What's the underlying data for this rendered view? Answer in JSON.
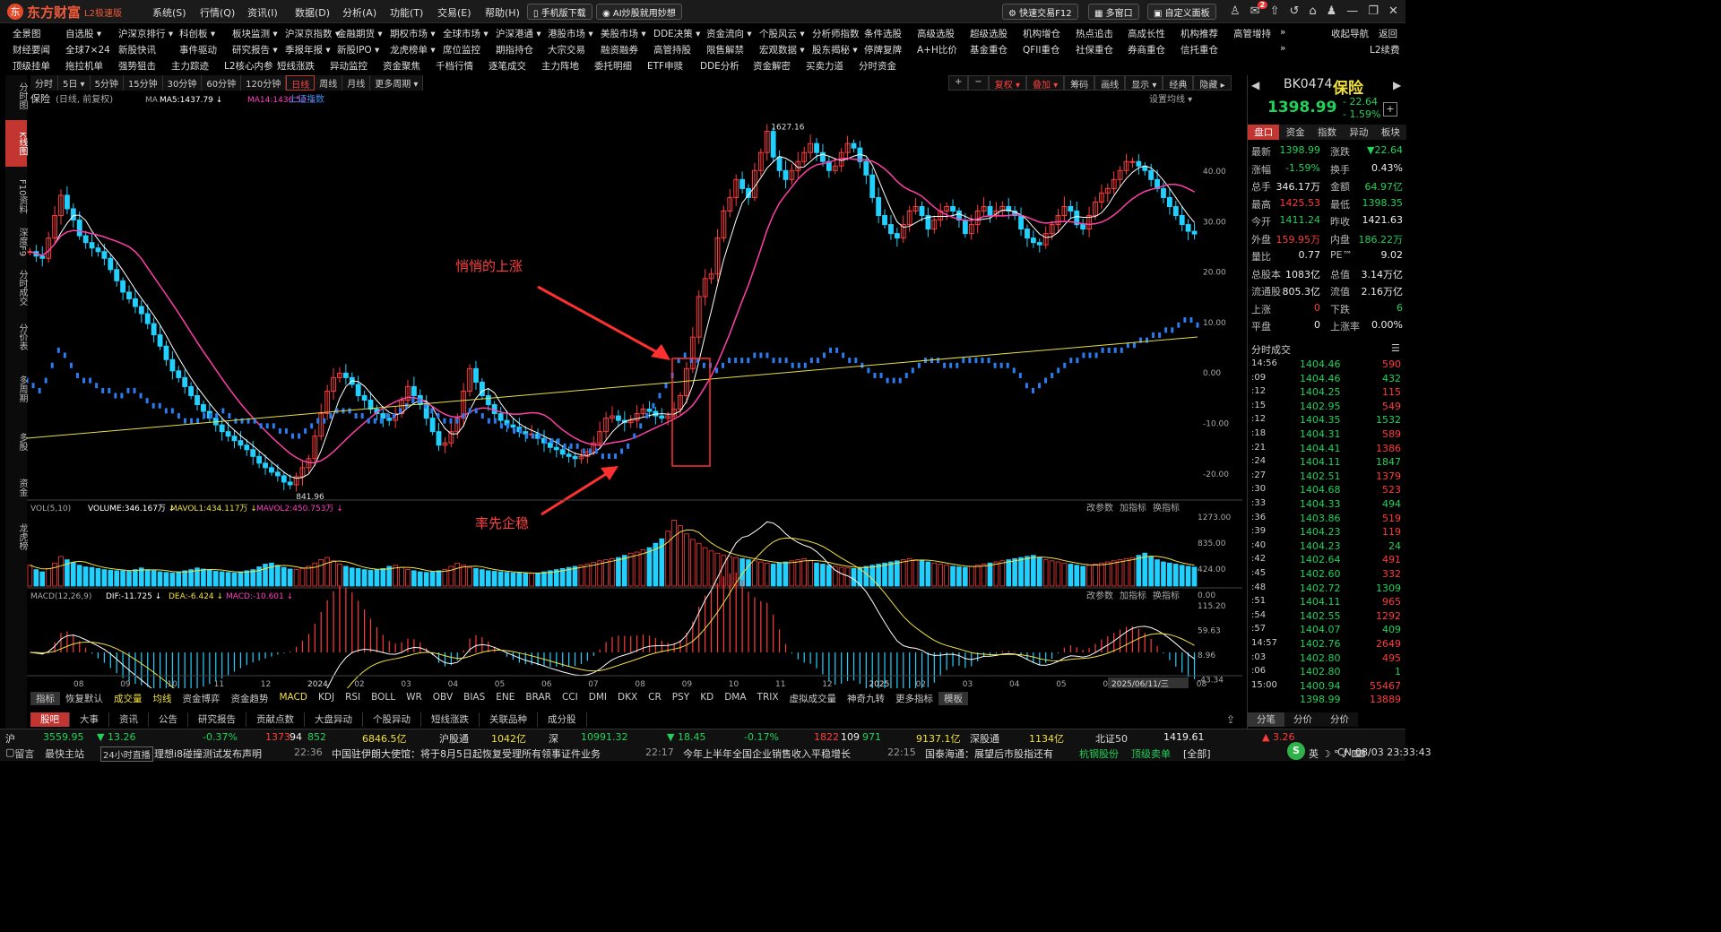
{
  "app": {
    "brand": "东方财富",
    "edition": "L2极速版",
    "menu": [
      "系统(S)",
      "行情(Q)",
      "资讯(I)",
      "数据(D)",
      "分析(A)",
      "功能(T)",
      "交易(E)",
      "帮助(H)"
    ],
    "mobile_btn": "手机版下载",
    "ai_btn": "AI炒股就用妙想",
    "fast_trade": "快速交易F12",
    "multi_window": "多窗口",
    "custom_panel": "自定义面板",
    "notif_count": "2"
  },
  "nav_row1": [
    "全景图",
    "自选股 ▾",
    "沪深京排行 ▾",
    "科创板 ▾",
    "板块监测 ▾",
    "沪深京指数 ▾",
    "金融期货 ▾",
    "期权市场 ▾",
    "全球市场 ▾",
    "沪深港通 ▾",
    "港股市场 ▾",
    "美股市场 ▾",
    "DDE决策 ▾",
    "资金流向 ▾",
    "个股风云 ▾",
    "分析师指数",
    "条件选股",
    "高级选股",
    "超级选股",
    "机构增仓",
    "热点追击",
    "高成长性",
    "机构推荐",
    "高管增持",
    "»",
    "收起导航",
    "返回"
  ],
  "nav_row2": [
    "财经要闻",
    "全球7×24",
    "新股快讯",
    "事件驱动",
    "研究报告 ▾",
    "季报年报 ▾",
    "新股IPO ▾",
    "龙虎榜单 ▾",
    "席位监控",
    "期指持仓",
    "大宗交易",
    "融资融券",
    "高管持股",
    "限售解禁",
    "宏观数据 ▾",
    "股东揭秘 ▾",
    "停牌复牌",
    "A+H比价",
    "基金重仓",
    "QFII重仓",
    "社保重仓",
    "券商重仓",
    "信托重仓",
    "»",
    "L2续费"
  ],
  "nav_row3": [
    "顶级挂单",
    "拖拉机单",
    "强势狙击",
    "主力踪迹",
    "L2核心内参",
    "短线涨跌",
    "异动监控",
    "资金聚焦",
    "千档行情",
    "逐笔成交",
    "主力阵地",
    "委托明细",
    "ETF申赎",
    "DDE分析",
    "资金解密",
    "买卖力道",
    "分时资金"
  ],
  "sidebar": [
    "分时图",
    "K线图",
    "F10资料",
    "深度F9",
    "分时成交",
    "分价表",
    "多周期",
    "多股",
    "资金",
    "龙虎榜"
  ],
  "timeframes": [
    "分时",
    "5日 ▾",
    "5分钟",
    "15分钟",
    "30分钟",
    "60分钟",
    "120分钟",
    "日线",
    "周线",
    "月线",
    "更多周期 ▾"
  ],
  "toolbar_right": [
    "+",
    "−",
    "复权 ▾",
    "叠加 ▾",
    "筹码",
    "画线",
    "显示 ▾",
    "经典",
    "隐藏 ▸"
  ],
  "kline_header": {
    "name": "保险",
    "mode": "(日线, 前复权)",
    "ma": "MA",
    "ma5": "MA5:1437.79 ↓",
    "ma14": "MA14:1436.50 ↓",
    "overlay": "上证指数",
    "settings": "设置均线 ▾"
  },
  "chart_data": {
    "type": "line",
    "title": "保险",
    "kline_close": [
      1360,
      1350,
      1345,
      1390,
      1440,
      1485,
      1455,
      1430,
      1395,
      1380,
      1368,
      1360,
      1345,
      1320,
      1295,
      1270,
      1255,
      1238,
      1222,
      1200,
      1175,
      1150,
      1120,
      1095,
      1080,
      1060,
      1040,
      1020,
      1005,
      990,
      975,
      960,
      950,
      940,
      930,
      920,
      905,
      890,
      880,
      870,
      862,
      848,
      842,
      860,
      880,
      900,
      950,
      1000,
      1050,
      1080,
      1090,
      1080,
      1065,
      1040,
      1030,
      1010,
      1000,
      990,
      985,
      1000,
      1030,
      1060,
      1040,
      1020,
      990,
      960,
      930,
      935,
      960,
      990,
      1050,
      1100,
      1070,
      1040,
      1020,
      1000,
      985,
      975,
      970,
      960,
      955,
      955,
      945,
      935,
      925,
      920,
      910,
      905,
      900,
      905,
      915,
      935,
      960,
      990,
      995,
      985,
      980,
      985,
      1000,
      1010,
      1005,
      995,
      990,
      995,
      1010,
      1040,
      1100,
      1170,
      1260,
      1300,
      1310,
      1390,
      1450,
      1480,
      1520,
      1500,
      1480,
      1540,
      1580,
      1627,
      1570,
      1540,
      1520,
      1540,
      1560,
      1580,
      1600,
      1580,
      1560,
      1540,
      1550,
      1580,
      1600,
      1590,
      1560,
      1530,
      1480,
      1440,
      1420,
      1400,
      1390,
      1420,
      1450,
      1460,
      1440,
      1410,
      1430,
      1450,
      1460,
      1450,
      1430,
      1400,
      1420,
      1450,
      1460,
      1440,
      1450,
      1460,
      1450,
      1440,
      1410,
      1390,
      1380,
      1375,
      1400,
      1420,
      1440,
      1460,
      1450,
      1420,
      1410,
      1440,
      1470,
      1490,
      1500,
      1520,
      1540,
      1560,
      1560,
      1550,
      1540,
      1520,
      1500,
      1480,
      1460,
      1440,
      1420,
      1405,
      1399
    ],
    "overlay_index_pct": [
      -1,
      -2,
      -3,
      -1,
      2,
      5,
      4,
      2,
      0,
      -1,
      -1,
      -2,
      -3,
      -3,
      -4,
      -4,
      -3,
      -3,
      -4,
      -5,
      -6,
      -6,
      -7,
      -7,
      -8,
      -9,
      -9,
      -9,
      -8,
      -8,
      -8,
      -7,
      -8,
      -9,
      -9,
      -9,
      -9,
      -10,
      -10,
      -10,
      -11,
      -11,
      -12,
      -12,
      -11,
      -10,
      -9,
      -9,
      -8,
      -7,
      -7,
      -7,
      -8,
      -8,
      -9,
      -9,
      -9,
      -8,
      -8,
      -7,
      -6,
      -5,
      -5,
      -6,
      -7,
      -8,
      -9,
      -9,
      -9,
      -8,
      -7,
      -7,
      -8,
      -9,
      -9,
      -10,
      -10,
      -11,
      -11,
      -12,
      -12,
      -12,
      -13,
      -13,
      -13,
      -14,
      -14,
      -14,
      -15,
      -15,
      -15,
      -16,
      -16,
      -16,
      -15,
      -14,
      -12,
      -10,
      -8,
      -6,
      -4,
      -2,
      0,
      3,
      4,
      3,
      3,
      2,
      2,
      1,
      2,
      3,
      3,
      3,
      3,
      4,
      4,
      4,
      3,
      3,
      3,
      2,
      2,
      2,
      3,
      3,
      4,
      5,
      5,
      4,
      3,
      3,
      2,
      1,
      0,
      0,
      -1,
      -1,
      -1,
      0,
      1,
      2,
      3,
      3,
      3,
      2,
      2,
      2,
      3,
      3,
      3,
      3,
      3,
      2,
      2,
      2,
      1,
      0,
      -2,
      -3,
      -2,
      -1,
      0,
      1,
      2,
      3,
      3,
      4,
      4,
      4,
      5,
      5,
      5,
      5,
      6,
      6,
      7,
      7,
      8,
      8,
      9,
      9,
      10,
      11,
      11,
      10
    ],
    "y_price_range": [
      820,
      1660
    ],
    "y_pct_ticks": [
      "40.00",
      "30.00",
      "20.00",
      "10.00",
      "0.00",
      "-10.00",
      "-20.00"
    ],
    "x_month_ticks": [
      "08",
      "09",
      "10",
      "11",
      "12",
      "2024",
      "02",
      "03",
      "04",
      "05",
      "06",
      "07",
      "08",
      "09",
      "10",
      "11",
      "12",
      "2025",
      "02",
      "03",
      "04",
      "05",
      "06",
      "07",
      "08"
    ],
    "max_label": "1627.16",
    "min_label": "841.96",
    "annotations": [
      "悄悄的上涨",
      "率先企稳"
    ]
  },
  "vol_panel": {
    "title": "VOL(5,10)",
    "vol": "VOLUME:346.167万 ↓",
    "mavol1": "MAVOL1:434.117万 ↓",
    "mavol2": "MAVOL2:450.753万 ↓",
    "y_ticks": [
      "1273.00",
      "835.00",
      "424.00",
      "0.00"
    ],
    "values": [
      380,
      300,
      260,
      320,
      420,
      540,
      480,
      430,
      380,
      350,
      340,
      320,
      300,
      290,
      280,
      280,
      270,
      300,
      330,
      300,
      280,
      260,
      250,
      240,
      260,
      280,
      300,
      330,
      310,
      290,
      270,
      260,
      250,
      240,
      260,
      280,
      300,
      350,
      400,
      420,
      380,
      340,
      310,
      300,
      320,
      360,
      420,
      480,
      520,
      460,
      400,
      360,
      330,
      320,
      300,
      290,
      300,
      320,
      360,
      380,
      340,
      300,
      280,
      260,
      250,
      260,
      280,
      300,
      360,
      420,
      380,
      340,
      320,
      300,
      280,
      270,
      260,
      250,
      240,
      240,
      230,
      230,
      240,
      260,
      280,
      300,
      320,
      340,
      360,
      380,
      400,
      430,
      460,
      480,
      500,
      520,
      560,
      600,
      620,
      660,
      700,
      780,
      860,
      1000,
      1200,
      1100,
      950,
      850,
      780,
      700,
      640,
      600,
      560,
      540,
      520,
      500,
      480,
      460,
      440,
      420,
      400,
      420,
      440,
      460,
      480,
      500,
      460,
      420,
      400,
      380,
      360,
      340,
      330,
      320,
      340,
      360,
      380,
      400,
      420,
      440,
      460,
      480,
      500,
      480,
      460,
      440,
      420,
      400,
      380,
      360,
      350,
      340,
      360,
      380,
      400,
      420,
      440,
      460,
      480,
      500,
      520,
      540,
      560,
      520,
      480,
      460,
      440,
      420,
      400,
      380,
      360,
      380,
      400,
      420,
      440,
      460,
      480,
      500,
      520,
      560,
      600,
      540,
      480,
      440,
      420,
      400,
      380,
      360,
      346
    ],
    "right_btns": [
      "改参数",
      "加指标",
      "换指标"
    ]
  },
  "macd_panel": {
    "title": "MACD(12,26,9)",
    "dif": "DIF:-11.725 ↓",
    "dea": "DEA:-6.424 ↓",
    "macd": "MACD:-10.601 ↓",
    "y_ticks": [
      "115.20",
      "59.63",
      "8.96",
      "-43.34"
    ],
    "right_btns": [
      "改参数",
      "加指标",
      "换指标"
    ]
  },
  "date_label": "2025/06/11/三",
  "indicator_tabs": [
    "指标",
    "恢复默认",
    "成交量",
    "均线",
    "资金博弈",
    "资金趋势",
    "MACD",
    "KDJ",
    "RSI",
    "BOLL",
    "WR",
    "OBV",
    "BIAS",
    "ENE",
    "BRAR",
    "CCI",
    "DMI",
    "DKX",
    "CR",
    "PSY",
    "KD",
    "DMA",
    "TRIX",
    "虚拟成交量",
    "神奇九转",
    "更多指标",
    "模板"
  ],
  "bottom_tabs": [
    "股吧",
    "大事",
    "资讯",
    "公告",
    "研究报告",
    "贡献点数",
    "大盘异动",
    "个股异动",
    "短线涨跌",
    "关联品种",
    "成分股"
  ],
  "quote": {
    "code": "BK0474",
    "name": "保险",
    "price": "1398.99",
    "change": "- 22.64",
    "pct": "- 1.59%",
    "tabs": [
      "盘口",
      "资金",
      "指数",
      "异动",
      "板块"
    ],
    "rows": [
      [
        "最新",
        "1398.99",
        "涨跌",
        "▼22.64"
      ],
      [
        "涨幅",
        "-1.59%",
        "换手",
        "0.43%"
      ],
      [
        "总手",
        "346.17万",
        "金额",
        "64.97亿"
      ],
      [
        "最高",
        "1425.53",
        "最低",
        "1398.35"
      ],
      [
        "今开",
        "1411.24",
        "昨收",
        "1421.63"
      ],
      [
        "外盘",
        "159.95万",
        "内盘",
        "186.22万"
      ],
      [
        "量比",
        "0.77",
        "PE™",
        "9.02"
      ],
      [
        "总股本",
        "1083亿",
        "总值",
        "3.14万亿"
      ],
      [
        "流通股",
        "805.3亿",
        "流值",
        "2.16万亿"
      ],
      [
        "上涨",
        "0",
        "下跌",
        "6"
      ],
      [
        "平盘",
        "0",
        "上涨率",
        "0.00%"
      ]
    ],
    "ticks_title": "分时成交",
    "ticks": [
      [
        "14:56",
        "1404.46",
        "590"
      ],
      [
        ":09",
        "1404.46",
        "432"
      ],
      [
        ":12",
        "1404.25",
        "115"
      ],
      [
        ":15",
        "1402.95",
        "549"
      ],
      [
        ":12",
        "1404.35",
        "1532"
      ],
      [
        ":18",
        "1404.31",
        "589"
      ],
      [
        ":21",
        "1404.41",
        "1386"
      ],
      [
        ":24",
        "1404.11",
        "1847"
      ],
      [
        ":27",
        "1402.51",
        "1379"
      ],
      [
        ":30",
        "1404.68",
        "523"
      ],
      [
        ":33",
        "1404.33",
        "494"
      ],
      [
        ":36",
        "1403.86",
        "519"
      ],
      [
        ":39",
        "1404.23",
        "119"
      ],
      [
        ":40",
        "1404.23",
        "24"
      ],
      [
        ":42",
        "1402.64",
        "491"
      ],
      [
        ":45",
        "1402.60",
        "332"
      ],
      [
        ":48",
        "1402.72",
        "1309"
      ],
      [
        ":51",
        "1404.11",
        "965"
      ],
      [
        ":54",
        "1402.55",
        "1292"
      ],
      [
        ":57",
        "1404.07",
        "409"
      ],
      [
        "14:57",
        "1402.76",
        "2649"
      ],
      [
        ":03",
        "1402.80",
        "495"
      ],
      [
        ":06",
        "1402.80",
        "1"
      ],
      [
        "15:00",
        "1400.94",
        "55467"
      ],
      [
        "",
        "1398.99",
        "13889"
      ]
    ],
    "bottom_tabs": [
      "分笔",
      "分价",
      "分价"
    ]
  },
  "statusbar": {
    "hu_label": "沪",
    "sh": "3559.95",
    "sh_pct": "-0.37%",
    "sh_chg": "▼ 13.26",
    "sh_up": "1373",
    "sh_dn": "94",
    "sh_flat": "852",
    "sh_amt": "6846.5亿",
    "hgt_label": "沪股通",
    "hgt": "1042亿",
    "shen_label": "深",
    "sz": "10991.32",
    "sz_chg": "▼ 18.45",
    "sz_pct": "-0.17%",
    "sz_up": "1822",
    "sz_dn": "109",
    "sz_flat": "971",
    "sz_amt": "9137.1亿",
    "sgt_label": "深股通",
    "sgt": "1134亿",
    "bz50_label": "北证50",
    "bz50": "1419.61",
    "bz_chg": "▲ 3.26",
    "news_left": "留言",
    "news_1": "最快主站",
    "news_2": "24小时直播",
    "news_3": "理想i8碰撞测试发布声明",
    "t1": "22:36",
    "n1": "中国驻伊朗大使馆：将于8月5日起恢复受理所有领事证件业务",
    "t2": "22:17",
    "n2": "今年上半年全国企业销售收入平稳增长",
    "t3": "22:15",
    "n3": "国泰海通：展望后市股指还有",
    "stock": "杭钢股份",
    "tag": "顶级卖单",
    "all": "[全部]",
    "time": "08/03 23:33:43",
    "cn": "CN"
  }
}
